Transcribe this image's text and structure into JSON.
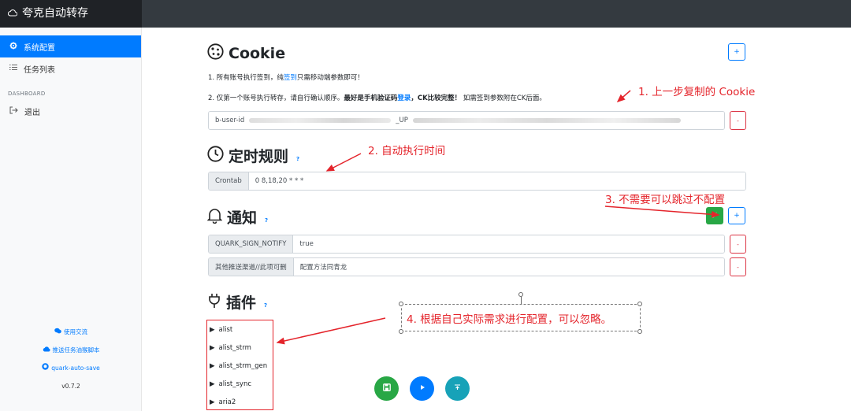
{
  "app": {
    "title": "夸克自动转存"
  },
  "sidebar": {
    "items": [
      {
        "label": "系统配置",
        "icon": "gear-icon",
        "active": true
      },
      {
        "label": "任务列表",
        "icon": "list-icon",
        "active": false
      }
    ],
    "section_label": "DASHBOARD",
    "logout_label": "退出",
    "links": [
      {
        "label": "使用交流",
        "icon": "chat-icon"
      },
      {
        "label": "推送任务油猴脚本",
        "icon": "cloud-icon"
      },
      {
        "label": "quark-auto-save",
        "icon": "github-icon"
      }
    ],
    "version": "v0.7.2"
  },
  "cookie": {
    "title": "Cookie",
    "line1_a": "1. 所有账号执行签到，纯",
    "line1_link": "签到",
    "line1_b": "只需移动端参数即可！",
    "line2_a": "2. 仅第一个账号执行转存，请自行确认顺序。",
    "line2_bold1": "最好是手机验证码",
    "line2_bold_link": "登录",
    "line2_bold2": "，CK比较完整！",
    "line2_b": " 如需签到参数附在CK后面。",
    "value_visible": "b-user-id",
    "value_mid": "_UP",
    "add_label": "+",
    "remove_label": "-"
  },
  "schedule": {
    "title": "定时规则",
    "help": "?",
    "crontab_label": "Crontab",
    "crontab_value": "0 8,18,20 * * *"
  },
  "notify": {
    "title": "通知",
    "help": "?",
    "test_label": "⚡",
    "add_label": "+",
    "rows": [
      {
        "label": "QUARK_SIGN_NOTIFY",
        "value": "true",
        "remove": "-"
      },
      {
        "label": "其他推送渠道//此项可删",
        "value": "配置方法同青龙",
        "remove": "-"
      }
    ]
  },
  "plugins": {
    "title": "插件",
    "help": "?",
    "items": [
      "alist",
      "alist_strm",
      "alist_strm_gen",
      "alist_sync",
      "aria2"
    ]
  },
  "fabs": {
    "save_icon": "save-icon",
    "run_icon": "play-icon",
    "top_icon": "arrow-up-icon",
    "colors": {
      "save": "#28a745",
      "run": "#007bff",
      "top": "#17a2b8"
    }
  },
  "annotations": {
    "a1": "1. 上一步复制的 Cookie",
    "a2": "2. 自动执行时间",
    "a3": "3. 不需要可以跳过不配置",
    "a4": "4. 根据自己实际需求进行配置，可以忽略。"
  }
}
